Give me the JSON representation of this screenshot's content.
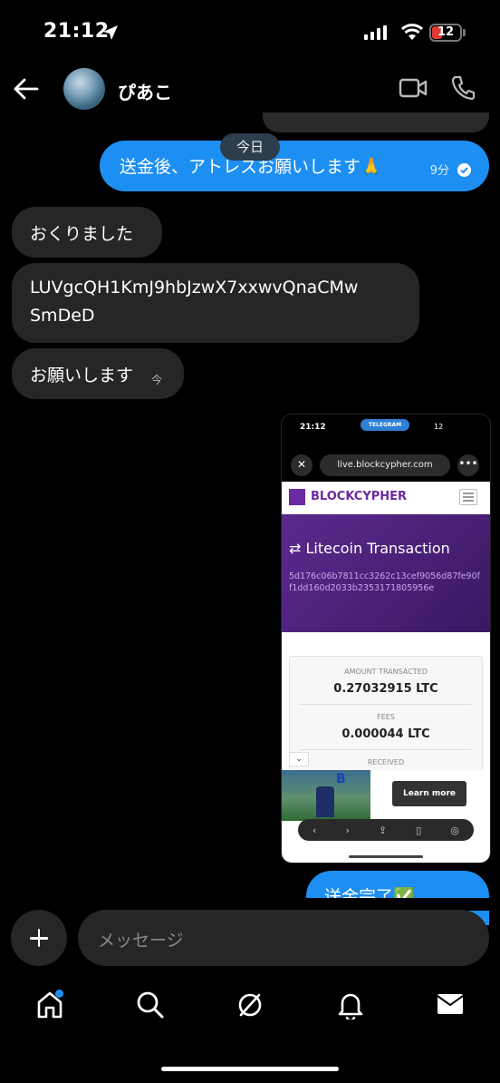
{
  "status_bar": {
    "time": "21:12",
    "battery": "12",
    "battery_color": "#e53935"
  },
  "header": {
    "contact_name": "ぴあこ"
  },
  "date_separator": "今日",
  "messages": [
    {
      "text": "送金後、アトレスお願いします🙏",
      "time": "9分",
      "side": "out"
    },
    {
      "text": "おくりました",
      "side": "in"
    },
    {
      "line1": "LUVgcQH1KmJ9hbJzwX7xxwvQnaCMw",
      "line2": "SmDeD",
      "side": "in"
    },
    {
      "text": "お願いします",
      "time": "今",
      "side": "in"
    },
    {
      "text": "送金完了✅",
      "side": "out"
    }
  ],
  "attachment": {
    "status_time": "21:12",
    "telegram_badge": "TELEGRAM",
    "status_battery": "12",
    "url": "live.blockcypher.com",
    "logo": "BLOCKCYPHER",
    "title": "⇄ Litecoin Transaction",
    "tx_hash": "5d176c06b7811cc3262c13cef9056d87fe90ff1dd160d2033b2353171805956e",
    "amount_label": "AMOUNT TRANSACTED",
    "amount_value": "0.27032915 LTC",
    "fees_label": "FEES",
    "fees_value": "0.000044 LTC",
    "received_label": "RECEIVED",
    "ad_letter": "B",
    "ad_button": "Learn more"
  },
  "composer": {
    "placeholder": "メッセージ"
  },
  "tabs": [
    "home-icon",
    "search-icon",
    "explore-icon",
    "bell-icon",
    "mail-icon"
  ],
  "colors": {
    "accent": "#1e8ff2",
    "bubble_in": "#262626",
    "background": "#000000"
  }
}
